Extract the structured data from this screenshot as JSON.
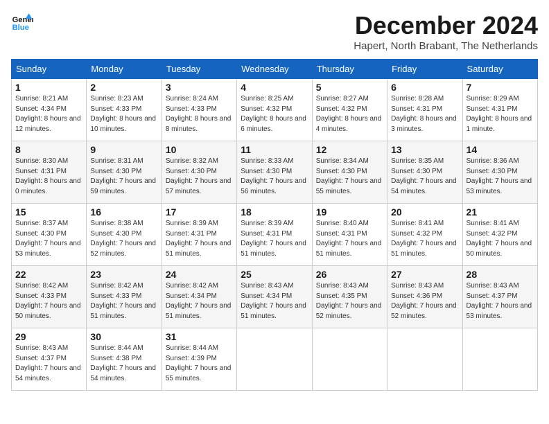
{
  "header": {
    "logo_line1": "General",
    "logo_line2": "Blue",
    "month_title": "December 2024",
    "location": "Hapert, North Brabant, The Netherlands"
  },
  "days_of_week": [
    "Sunday",
    "Monday",
    "Tuesday",
    "Wednesday",
    "Thursday",
    "Friday",
    "Saturday"
  ],
  "weeks": [
    [
      {
        "day": "1",
        "sunrise": "8:21 AM",
        "sunset": "4:34 PM",
        "daylight": "8 hours and 12 minutes."
      },
      {
        "day": "2",
        "sunrise": "8:23 AM",
        "sunset": "4:33 PM",
        "daylight": "8 hours and 10 minutes."
      },
      {
        "day": "3",
        "sunrise": "8:24 AM",
        "sunset": "4:33 PM",
        "daylight": "8 hours and 8 minutes."
      },
      {
        "day": "4",
        "sunrise": "8:25 AM",
        "sunset": "4:32 PM",
        "daylight": "8 hours and 6 minutes."
      },
      {
        "day": "5",
        "sunrise": "8:27 AM",
        "sunset": "4:32 PM",
        "daylight": "8 hours and 4 minutes."
      },
      {
        "day": "6",
        "sunrise": "8:28 AM",
        "sunset": "4:31 PM",
        "daylight": "8 hours and 3 minutes."
      },
      {
        "day": "7",
        "sunrise": "8:29 AM",
        "sunset": "4:31 PM",
        "daylight": "8 hours and 1 minute."
      }
    ],
    [
      {
        "day": "8",
        "sunrise": "8:30 AM",
        "sunset": "4:31 PM",
        "daylight": "8 hours and 0 minutes."
      },
      {
        "day": "9",
        "sunrise": "8:31 AM",
        "sunset": "4:30 PM",
        "daylight": "7 hours and 59 minutes."
      },
      {
        "day": "10",
        "sunrise": "8:32 AM",
        "sunset": "4:30 PM",
        "daylight": "7 hours and 57 minutes."
      },
      {
        "day": "11",
        "sunrise": "8:33 AM",
        "sunset": "4:30 PM",
        "daylight": "7 hours and 56 minutes."
      },
      {
        "day": "12",
        "sunrise": "8:34 AM",
        "sunset": "4:30 PM",
        "daylight": "7 hours and 55 minutes."
      },
      {
        "day": "13",
        "sunrise": "8:35 AM",
        "sunset": "4:30 PM",
        "daylight": "7 hours and 54 minutes."
      },
      {
        "day": "14",
        "sunrise": "8:36 AM",
        "sunset": "4:30 PM",
        "daylight": "7 hours and 53 minutes."
      }
    ],
    [
      {
        "day": "15",
        "sunrise": "8:37 AM",
        "sunset": "4:30 PM",
        "daylight": "7 hours and 53 minutes."
      },
      {
        "day": "16",
        "sunrise": "8:38 AM",
        "sunset": "4:30 PM",
        "daylight": "7 hours and 52 minutes."
      },
      {
        "day": "17",
        "sunrise": "8:39 AM",
        "sunset": "4:31 PM",
        "daylight": "7 hours and 51 minutes."
      },
      {
        "day": "18",
        "sunrise": "8:39 AM",
        "sunset": "4:31 PM",
        "daylight": "7 hours and 51 minutes."
      },
      {
        "day": "19",
        "sunrise": "8:40 AM",
        "sunset": "4:31 PM",
        "daylight": "7 hours and 51 minutes."
      },
      {
        "day": "20",
        "sunrise": "8:41 AM",
        "sunset": "4:32 PM",
        "daylight": "7 hours and 51 minutes."
      },
      {
        "day": "21",
        "sunrise": "8:41 AM",
        "sunset": "4:32 PM",
        "daylight": "7 hours and 50 minutes."
      }
    ],
    [
      {
        "day": "22",
        "sunrise": "8:42 AM",
        "sunset": "4:33 PM",
        "daylight": "7 hours and 50 minutes."
      },
      {
        "day": "23",
        "sunrise": "8:42 AM",
        "sunset": "4:33 PM",
        "daylight": "7 hours and 51 minutes."
      },
      {
        "day": "24",
        "sunrise": "8:42 AM",
        "sunset": "4:34 PM",
        "daylight": "7 hours and 51 minutes."
      },
      {
        "day": "25",
        "sunrise": "8:43 AM",
        "sunset": "4:34 PM",
        "daylight": "7 hours and 51 minutes."
      },
      {
        "day": "26",
        "sunrise": "8:43 AM",
        "sunset": "4:35 PM",
        "daylight": "7 hours and 52 minutes."
      },
      {
        "day": "27",
        "sunrise": "8:43 AM",
        "sunset": "4:36 PM",
        "daylight": "7 hours and 52 minutes."
      },
      {
        "day": "28",
        "sunrise": "8:43 AM",
        "sunset": "4:37 PM",
        "daylight": "7 hours and 53 minutes."
      }
    ],
    [
      {
        "day": "29",
        "sunrise": "8:43 AM",
        "sunset": "4:37 PM",
        "daylight": "7 hours and 54 minutes."
      },
      {
        "day": "30",
        "sunrise": "8:44 AM",
        "sunset": "4:38 PM",
        "daylight": "7 hours and 54 minutes."
      },
      {
        "day": "31",
        "sunrise": "8:44 AM",
        "sunset": "4:39 PM",
        "daylight": "7 hours and 55 minutes."
      },
      null,
      null,
      null,
      null
    ]
  ]
}
